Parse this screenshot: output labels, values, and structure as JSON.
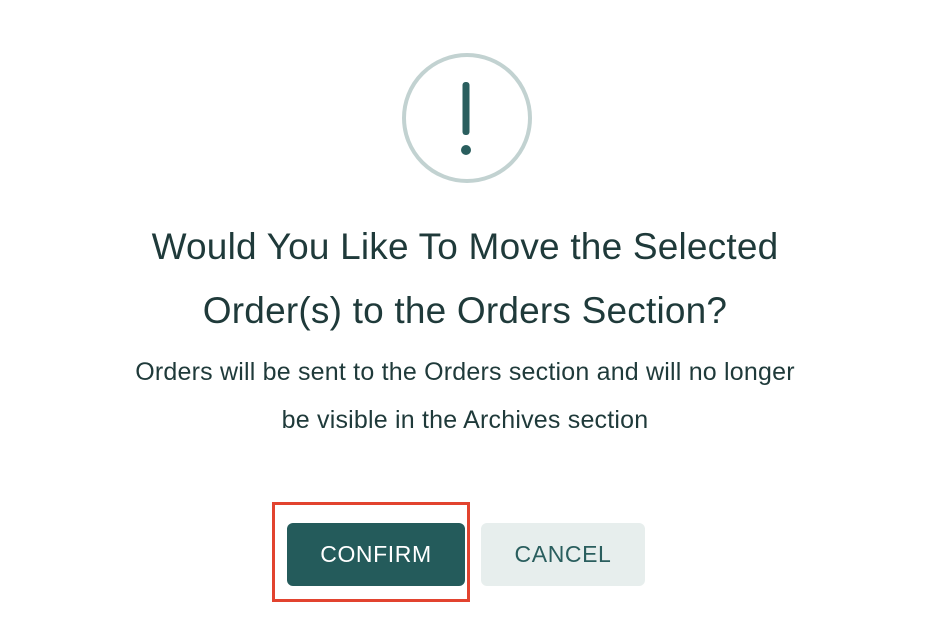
{
  "dialog": {
    "icon": "exclamation-icon",
    "title_lines": [
      "Would You Like To Move the Selected",
      "Order(s) to the Orders Section?"
    ],
    "message_lines": [
      "Orders will be sent to the Orders section and will no longer",
      "be visible in the Archives section"
    ],
    "buttons": {
      "confirm_label": "CONFIRM",
      "cancel_label": "CANCEL"
    }
  },
  "colors": {
    "primary": "#245b5b",
    "icon_ring": "#c2d2d1",
    "text": "#1f3a3a",
    "secondary_button_bg": "#e7eeed",
    "highlight_border": "#e2432f"
  }
}
